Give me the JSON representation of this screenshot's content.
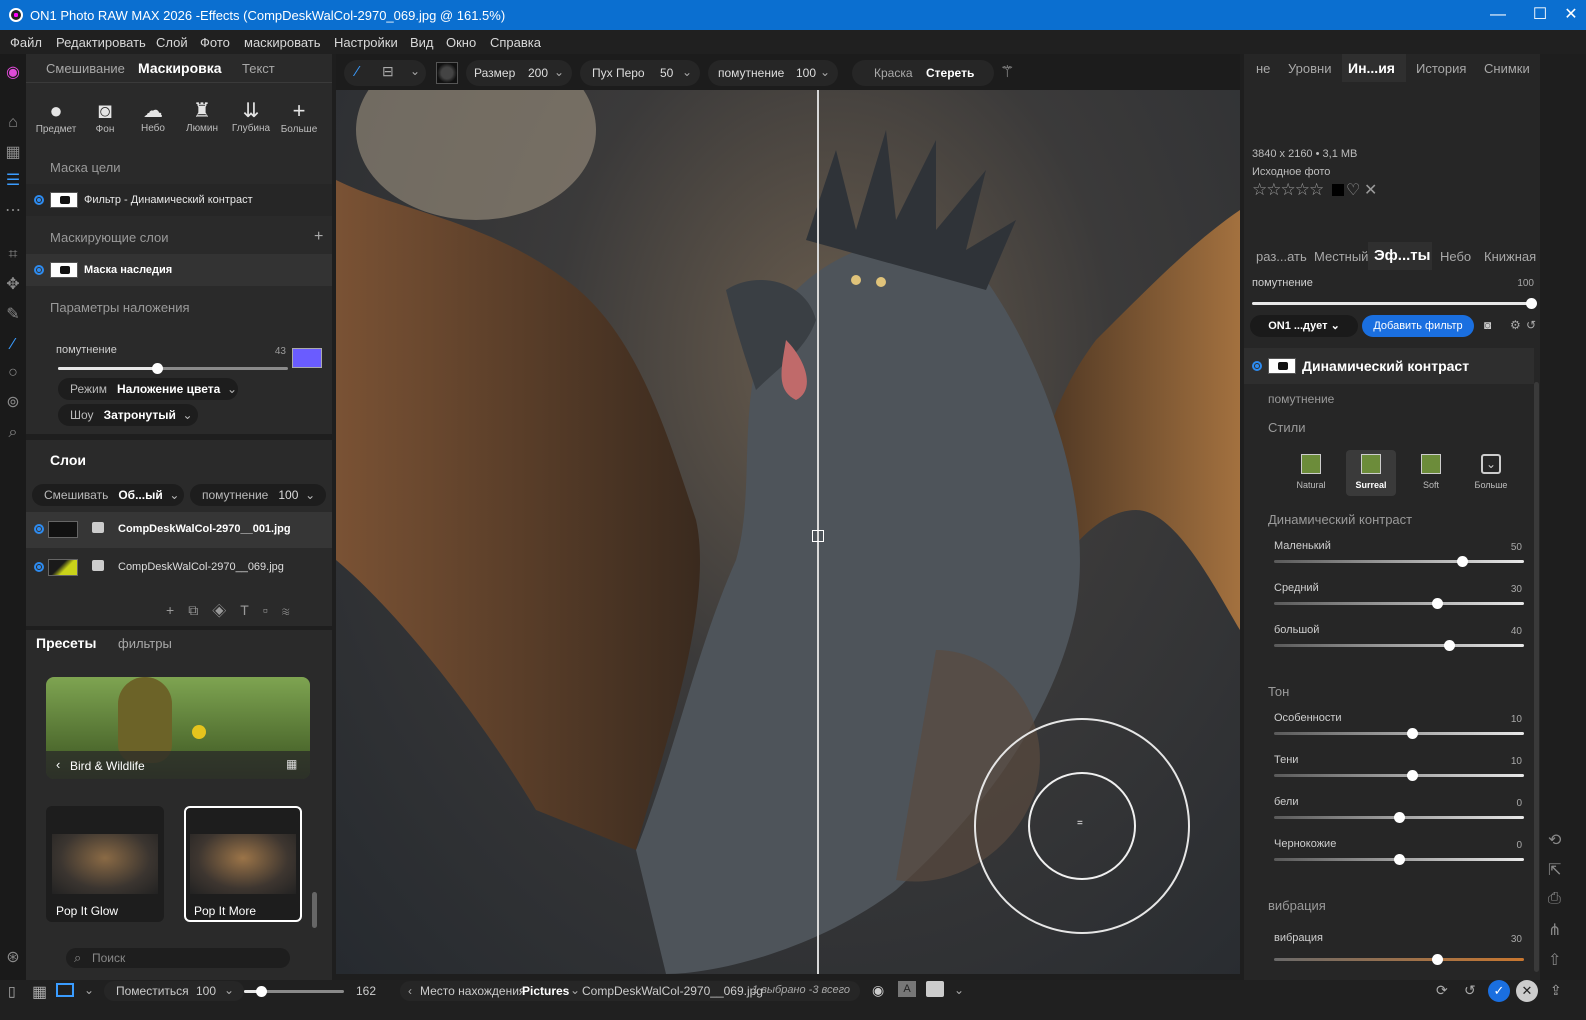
{
  "window": {
    "title": "ON1 Photo RAW MAX 2026 -Effects (CompDeskWalCol-2970_069.jpg @ 161.5%)",
    "min": "—",
    "max": "☐",
    "close": "✕"
  },
  "menu": [
    "Файл",
    "Редактировать",
    "Слой",
    "Фото",
    "маскировать",
    "Настройки",
    "Вид",
    "Окно",
    "Справка"
  ],
  "left_tabs": {
    "blend": "Смешивание",
    "mask": "Маскировка",
    "text": "Текст"
  },
  "mask_tools": [
    {
      "label": "Предмет"
    },
    {
      "label": "Фон"
    },
    {
      "label": "Небо"
    },
    {
      "label": "Люмин"
    },
    {
      "label": "Глубина"
    },
    {
      "label": "Больше"
    }
  ],
  "target_mask": {
    "header": "Маска цели",
    "item": "Фильтр - Динамический контраст"
  },
  "masking_layers": {
    "header": "Маскирующие слои",
    "add": "+",
    "item": "Маска наследия"
  },
  "overlay": {
    "header": "Параметры наложения",
    "opacity_label": "помутнение",
    "opacity_value": "43",
    "opacity_level": 0.43,
    "color": "#6a5cff",
    "mode_label": "Режим",
    "mode_value": "Наложение цвета",
    "show_label": "Шоу",
    "show_value": "Затронутый"
  },
  "layers": {
    "header": "Слои",
    "blend_label": "Смешивать",
    "blend_value": "Об...ый",
    "opacity_label": "помутнение",
    "opacity_value": "100",
    "items": [
      {
        "name": "CompDeskWalCol-2970__001.jpg"
      },
      {
        "name": "CompDeskWalCol-2970__069.jpg"
      }
    ]
  },
  "presets": {
    "tab_presets": "Пресеты",
    "tab_filters": "фильтры",
    "category": "Bird & Wildlife",
    "items": [
      {
        "name": "Pop It Glow"
      },
      {
        "name": "Pop It More"
      }
    ],
    "search_placeholder": "Поиск"
  },
  "toolbar": {
    "size_label": "Размер",
    "size_value": "200",
    "feather_label": "Пух Перо",
    "feather_value": "50",
    "opacity_label": "помутнение",
    "opacity_value": "100",
    "paint": "Краска",
    "erase": "Стереть"
  },
  "right_tabs": [
    "не",
    "Уровни",
    "Ин...ия",
    "История",
    "Снимки"
  ],
  "info": {
    "dims": "3840 x 2160",
    "size": "3,1 MB",
    "sep": "•",
    "label": "Исходное фото",
    "stars": "☆☆☆☆☆"
  },
  "module_tabs": [
    "раз...ать",
    "Местный",
    "Эф...ты",
    "Небо",
    "Книжная"
  ],
  "effects": {
    "opacity_label": "помутнение",
    "opacity_value": "100",
    "preset_btn": "ON1 ...дует",
    "add_filter": "Добавить фильтр",
    "filter_title": "Динамический контраст",
    "filter_opacity": "помутнение",
    "styles_label": "Стили",
    "styles": [
      {
        "name": "Natural"
      },
      {
        "name": "Surreal"
      },
      {
        "name": "Soft"
      },
      {
        "name": "Больше"
      }
    ],
    "dc_header": "Динамический контраст",
    "dc": [
      {
        "label": "Маленький",
        "value": "50",
        "pos": 0.75
      },
      {
        "label": "Средний",
        "value": "30",
        "pos": 0.65
      },
      {
        "label": "большой",
        "value": "40",
        "pos": 0.7
      }
    ],
    "tone_header": "Тон",
    "tone": [
      {
        "label": "Особенности",
        "value": "10",
        "pos": 0.55
      },
      {
        "label": "Тени",
        "value": "10",
        "pos": 0.55
      },
      {
        "label": "бели",
        "value": "0",
        "pos": 0.5
      },
      {
        "label": "Чернокожие",
        "value": "0",
        "pos": 0.5
      }
    ],
    "vib_header": "вибрация",
    "vib": {
      "label": "вибрация",
      "value": "30",
      "pos": 0.65
    }
  },
  "status": {
    "fit": "Поместиться",
    "zoom": "100",
    "zoom_level": 0.17,
    "max": "162",
    "location_label": "Место нахождения",
    "location": "Pictures",
    "file": "CompDeskWalCol-2970__069.jpg",
    "selection": "1 выбрано -3 всего"
  }
}
